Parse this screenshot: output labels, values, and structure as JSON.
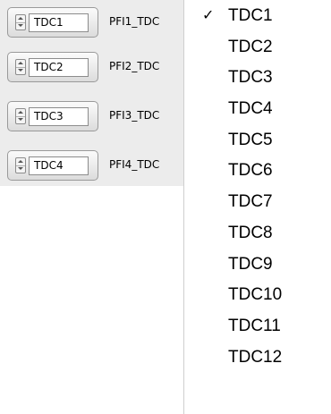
{
  "controls": [
    {
      "value": "TDC1",
      "label": "PFI1_TDC"
    },
    {
      "value": "TDC2",
      "label": "PFI2_TDC"
    },
    {
      "value": "TDC3",
      "label": "PFI3_TDC"
    },
    {
      "value": "TDC4",
      "label": "PFI4_TDC"
    }
  ],
  "menu": {
    "checked_item": "TDC1",
    "checkmark": "✓",
    "items": [
      "TDC1",
      "TDC2",
      "TDC3",
      "TDC4",
      "TDC5",
      "TDC6",
      "TDC7",
      "TDC8",
      "TDC9",
      "TDC10",
      "TDC11",
      "TDC12"
    ]
  }
}
